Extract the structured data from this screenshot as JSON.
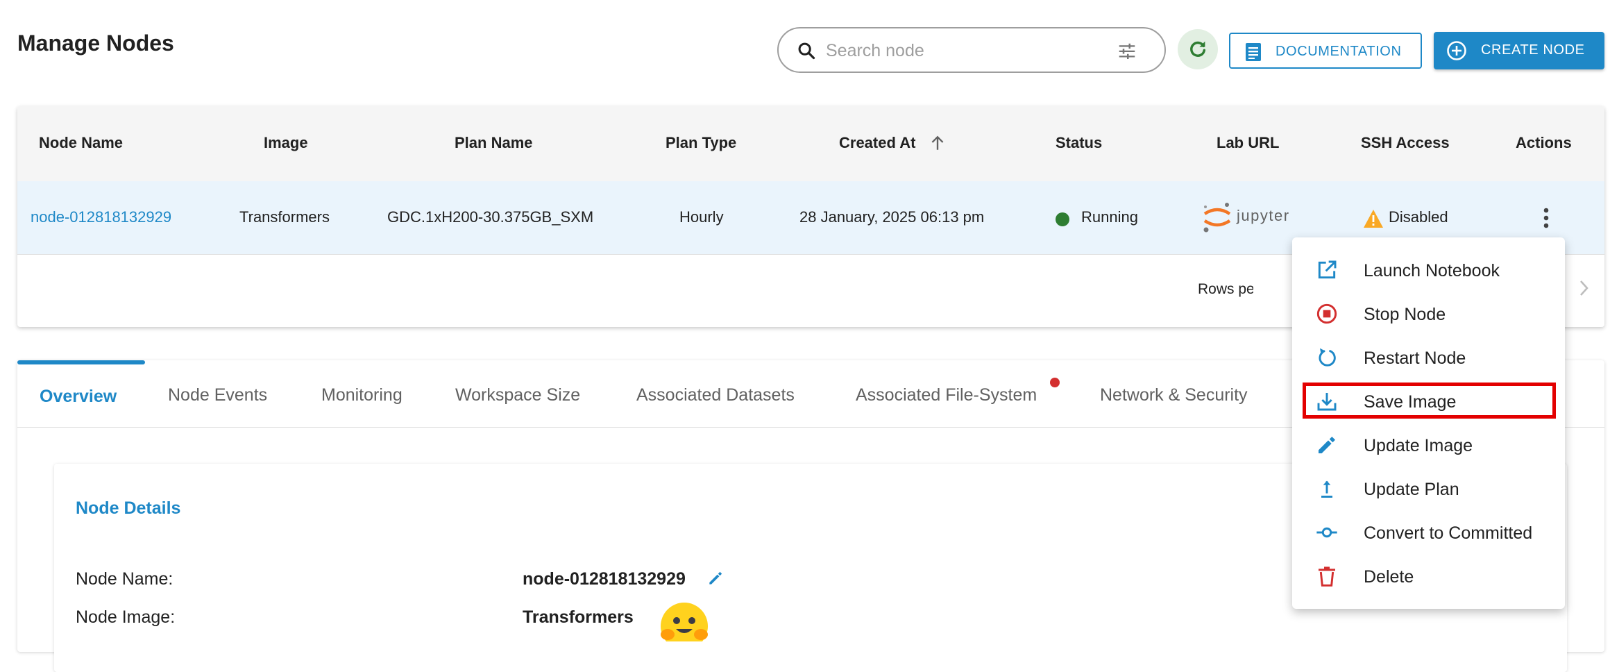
{
  "header": {
    "title": "Manage Nodes",
    "search_placeholder": "Search node",
    "documentation_label": "DOCUMENTATION",
    "create_node_label": "CREATE NODE"
  },
  "table": {
    "columns": [
      "Node Name",
      "Image",
      "Plan Name",
      "Plan Type",
      "Created At",
      "Status",
      "Lab URL",
      "SSH Access",
      "Actions"
    ],
    "sort": {
      "column": "Created At",
      "direction": "ascending"
    },
    "rows": [
      {
        "node_name": "node-012818132929",
        "image": "Transformers",
        "plan_name": "GDC.1xH200-30.375GB_SXM",
        "plan_type": "Hourly",
        "created_at": "28 January, 2025 06:13 pm",
        "status": "Running",
        "lab_url": "jupyter",
        "ssh_access": "Disabled"
      }
    ],
    "pagination": {
      "rows_per_page_label": "Rows per pag"
    }
  },
  "tabs": {
    "items": [
      "Overview",
      "Node Events",
      "Monitoring",
      "Workspace Size",
      "Associated Datasets",
      "Associated File-System",
      "Network & Security"
    ],
    "active": "Overview"
  },
  "details": {
    "title": "Node Details",
    "node_name_label": "Node Name:",
    "node_name_value": "node-012818132929",
    "node_image_label": "Node Image:",
    "node_image_value": "Transformers"
  },
  "actions_menu": {
    "items": [
      "Launch Notebook",
      "Stop Node",
      "Restart Node",
      "Save Image",
      "Update Image",
      "Update Plan",
      "Convert to Committed",
      "Delete"
    ],
    "highlighted": "Save Image"
  },
  "colors": {
    "accent": "#1e88c7",
    "running": "#2e7d32",
    "danger": "#d32f2f",
    "warning": "#f9a825",
    "highlight_border": "#e30000",
    "jupyter_orange": "#f37726"
  }
}
